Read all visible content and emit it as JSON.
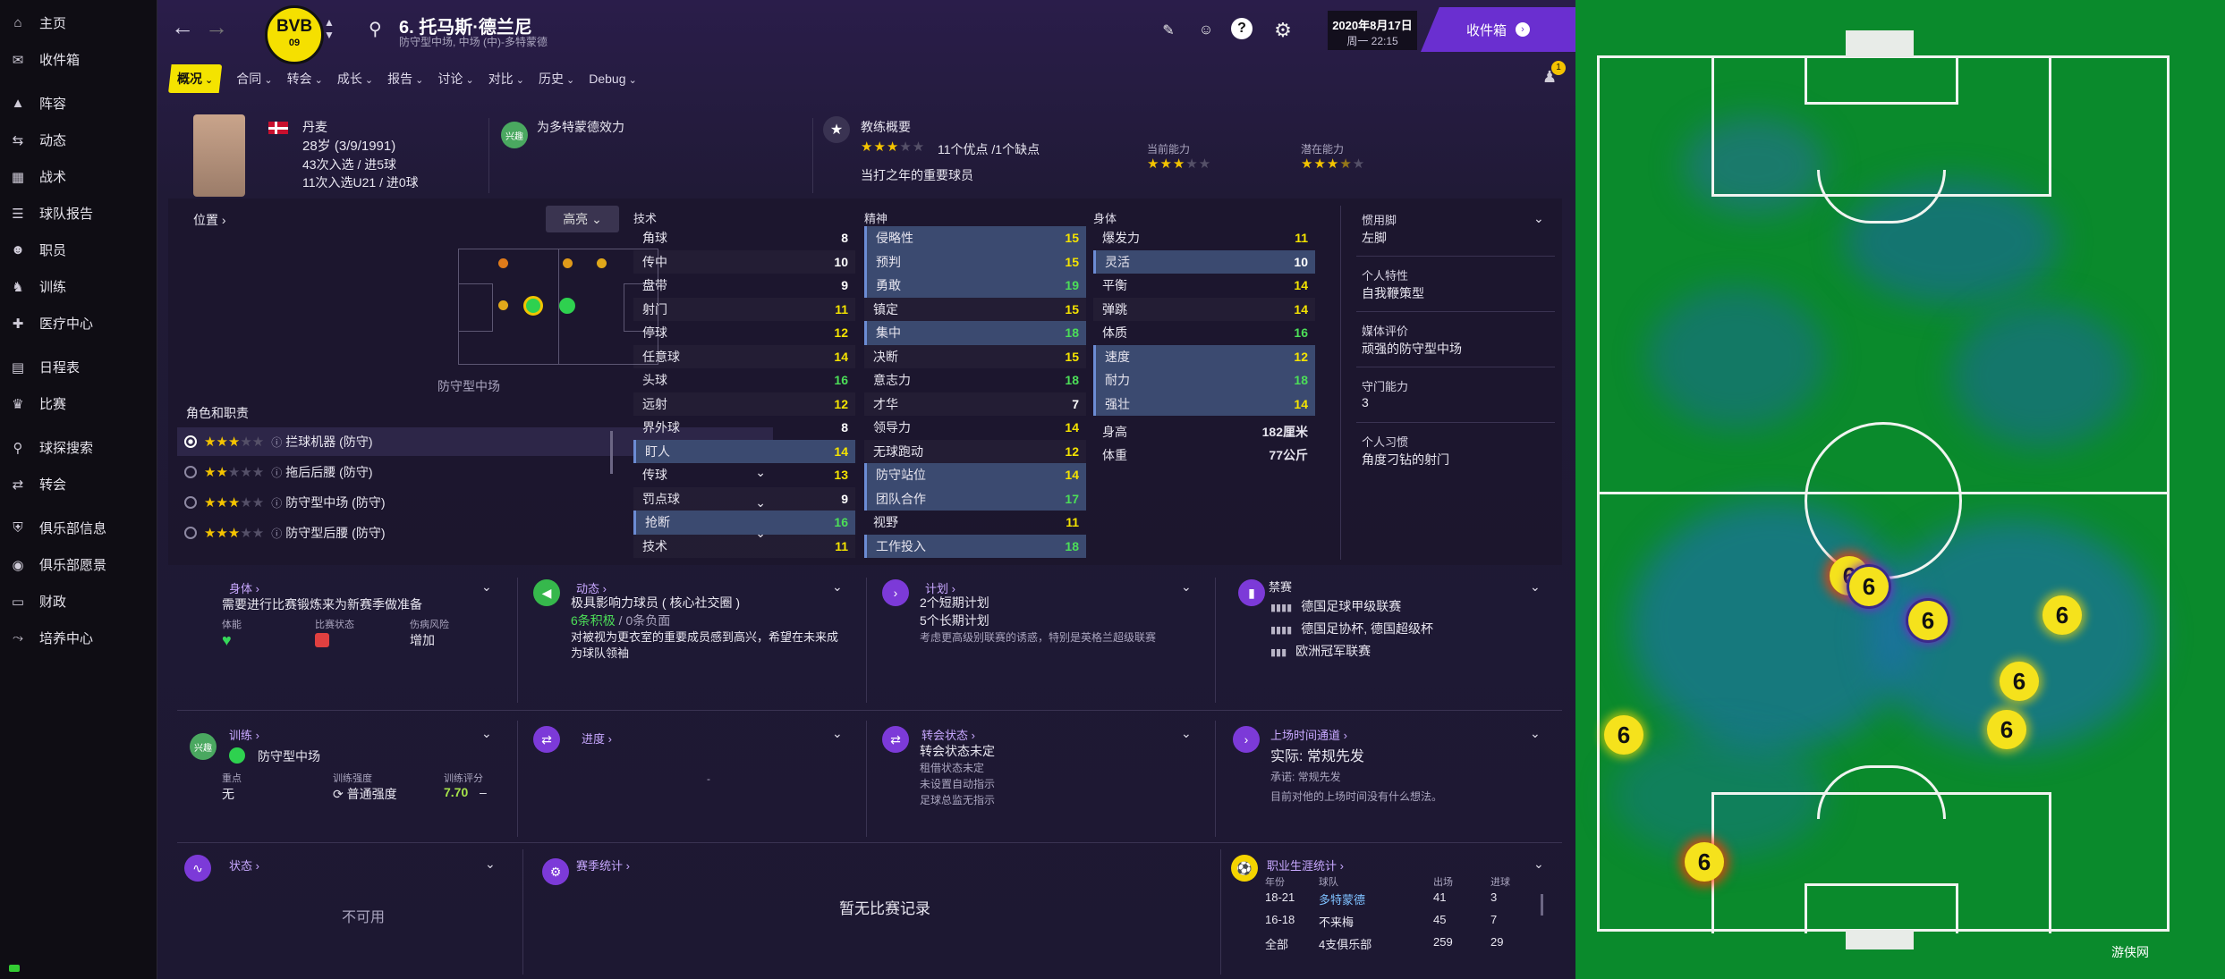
{
  "sidebar": {
    "items": [
      {
        "label": "主页",
        "icon": "home-icon"
      },
      {
        "label": "收件箱",
        "icon": "inbox-icon"
      },
      {
        "label": "阵容",
        "icon": "shirt-icon"
      },
      {
        "label": "动态",
        "icon": "dynamics-icon"
      },
      {
        "label": "战术",
        "icon": "tactics-icon"
      },
      {
        "label": "球队报告",
        "icon": "report-icon"
      },
      {
        "label": "职员",
        "icon": "staff-icon"
      },
      {
        "label": "训练",
        "icon": "training-icon"
      },
      {
        "label": "医疗中心",
        "icon": "medical-icon"
      },
      {
        "label": "日程表",
        "icon": "calendar-icon"
      },
      {
        "label": "比赛",
        "icon": "trophy-icon"
      },
      {
        "label": "球探搜索",
        "icon": "search-icon"
      },
      {
        "label": "转会",
        "icon": "transfer-icon"
      },
      {
        "label": "俱乐部信息",
        "icon": "shield-icon"
      },
      {
        "label": "俱乐部愿景",
        "icon": "vision-icon"
      },
      {
        "label": "财政",
        "icon": "finance-icon"
      },
      {
        "label": "培养中心",
        "icon": "development-icon"
      }
    ]
  },
  "header": {
    "crest_text": "BVB",
    "crest_year": "09",
    "player_name": "6. 托马斯·德兰尼",
    "player_sub": "防守型中场, 中场 (中)-多特蒙德",
    "date": "2020年8月17日",
    "time": "周一 22:15",
    "inbox_label": "收件箱",
    "notif_count": "1"
  },
  "tabs": [
    "概况",
    "合同",
    "转会",
    "成长",
    "报告",
    "讨论",
    "对比",
    "历史",
    "Debug"
  ],
  "profile": {
    "nation": "丹麦",
    "age_line": "28岁 (3/9/1991)",
    "caps_line": "43次入选 / 进5球",
    "u21_line": "11次入选U21 / 进0球",
    "club_badge": "兴趣",
    "club_line": "为多特蒙德效力",
    "coach_title": "教练概要",
    "coach_line": "11个优点 /1个缺点",
    "coach_desc": "当打之年的重要球员",
    "coach_stars": 3,
    "current_label": "当前能力",
    "current_stars": 3,
    "potential_label": "潜在能力",
    "potential_stars": 3.5
  },
  "position": {
    "title": "位置",
    "highlight_btn": "高亮",
    "pos_label": "防守型中场",
    "roles_title": "角色和职责",
    "roles": [
      {
        "name": "拦球机器 (防守)",
        "stars": 3
      },
      {
        "name": "拖后后腰 (防守)",
        "stars": 2
      },
      {
        "name": "防守型中场 (防守)",
        "stars": 3
      },
      {
        "name": "防守型后腰 (防守)",
        "stars": 3
      }
    ]
  },
  "attributes": {
    "tech_title": "技术",
    "mental_title": "精神",
    "phys_title": "身体",
    "technical": [
      {
        "n": "角球",
        "v": "8",
        "c": "w",
        "hl": false
      },
      {
        "n": "传中",
        "v": "10",
        "c": "w",
        "hl": false
      },
      {
        "n": "盘带",
        "v": "9",
        "c": "w",
        "hl": false
      },
      {
        "n": "射门",
        "v": "11",
        "c": "y",
        "hl": false
      },
      {
        "n": "停球",
        "v": "12",
        "c": "y",
        "hl": false
      },
      {
        "n": "任意球",
        "v": "14",
        "c": "y",
        "hl": false
      },
      {
        "n": "头球",
        "v": "16",
        "c": "g",
        "hl": false
      },
      {
        "n": "远射",
        "v": "12",
        "c": "y",
        "hl": false
      },
      {
        "n": "界外球",
        "v": "8",
        "c": "w",
        "hl": false
      },
      {
        "n": "盯人",
        "v": "14",
        "c": "y",
        "hl": true
      },
      {
        "n": "传球",
        "v": "13",
        "c": "y",
        "hl": false
      },
      {
        "n": "罚点球",
        "v": "9",
        "c": "w",
        "hl": false
      },
      {
        "n": "抢断",
        "v": "16",
        "c": "g",
        "hl": true
      },
      {
        "n": "技术",
        "v": "11",
        "c": "y",
        "hl": false
      }
    ],
    "mental": [
      {
        "n": "侵略性",
        "v": "15",
        "c": "y",
        "hl": true
      },
      {
        "n": "预判",
        "v": "15",
        "c": "y",
        "hl": true
      },
      {
        "n": "勇敢",
        "v": "19",
        "c": "g",
        "hl": true
      },
      {
        "n": "镇定",
        "v": "15",
        "c": "y",
        "hl": false
      },
      {
        "n": "集中",
        "v": "18",
        "c": "g",
        "hl": true
      },
      {
        "n": "决断",
        "v": "15",
        "c": "y",
        "hl": false
      },
      {
        "n": "意志力",
        "v": "18",
        "c": "g",
        "hl": false
      },
      {
        "n": "才华",
        "v": "7",
        "c": "w",
        "hl": false
      },
      {
        "n": "领导力",
        "v": "14",
        "c": "y",
        "hl": false
      },
      {
        "n": "无球跑动",
        "v": "12",
        "c": "y",
        "hl": false
      },
      {
        "n": "防守站位",
        "v": "14",
        "c": "y",
        "hl": true
      },
      {
        "n": "团队合作",
        "v": "17",
        "c": "g",
        "hl": true
      },
      {
        "n": "视野",
        "v": "11",
        "c": "y",
        "hl": false
      },
      {
        "n": "工作投入",
        "v": "18",
        "c": "g",
        "hl": true
      }
    ],
    "physical": [
      {
        "n": "爆发力",
        "v": "11",
        "c": "y",
        "hl": false
      },
      {
        "n": "灵活",
        "v": "10",
        "c": "w",
        "hl": true
      },
      {
        "n": "平衡",
        "v": "14",
        "c": "y",
        "hl": false
      },
      {
        "n": "弹跳",
        "v": "14",
        "c": "y",
        "hl": false
      },
      {
        "n": "体质",
        "v": "16",
        "c": "g",
        "hl": false
      },
      {
        "n": "速度",
        "v": "12",
        "c": "y",
        "hl": true
      },
      {
        "n": "耐力",
        "v": "18",
        "c": "g",
        "hl": true
      },
      {
        "n": "强壮",
        "v": "14",
        "c": "y",
        "hl": true
      }
    ],
    "height_label": "身高",
    "height_value": "182厘米",
    "weight_label": "体重",
    "weight_value": "77公斤"
  },
  "traits": [
    {
      "label": "惯用脚",
      "value": "左脚"
    },
    {
      "label": "个人特性",
      "value": "自我鞭策型"
    },
    {
      "label": "媒体评价",
      "value": "顽强的防守型中场"
    },
    {
      "label": "守门能力",
      "value": "3"
    },
    {
      "label": "个人习惯",
      "value": "角度刁钻的射门"
    }
  ],
  "cards": {
    "body": {
      "title": "身体",
      "desc": "需要进行比赛锻炼来为新赛季做准备",
      "l1": "体能",
      "l2": "比赛状态",
      "l3": "伤病风险",
      "v3": "增加"
    },
    "dyn": {
      "title": "动态",
      "line1": "极具影响力球员 ( 核心社交圈 )",
      "pos": "6条积极",
      "neg": " / 0条负面",
      "desc": "对被视为更衣室的重要成员感到高兴，希望在未来成为球队领袖"
    },
    "plan": {
      "title": "计划",
      "l1": "2个短期计划",
      "l2": "5个长期计划",
      "desc": "考虑更高级别联赛的诱惑，特别是英格兰超级联赛"
    },
    "ban": {
      "title": "禁赛",
      "items": [
        "德国足球甲级联赛",
        "德国足协杯, 德国超级杯",
        "欧洲冠军联赛"
      ]
    },
    "train": {
      "title": "训练",
      "badge": "兴趣",
      "role": "防守型中场",
      "focus_l": "重点",
      "focus_v": "无",
      "int_l": "训练强度",
      "int_v": "普通强度",
      "rating_l": "训练评分",
      "rating_v": "7.70"
    },
    "progress": {
      "title": "进度"
    },
    "transfer": {
      "title": "转会状态",
      "l1": "转会状态未定",
      "l2": "租借状态未定",
      "l3": "未设置自动指示",
      "l4": "足球总监无指示"
    },
    "playing": {
      "title": "上场时间通道",
      "l1": "实际: 常规先发",
      "l2": "承诺: 常规先发",
      "l3": "目前对他的上场时间没有什么想法。"
    },
    "form": {
      "title": "状态",
      "na": "不可用"
    },
    "season": {
      "title": "赛季统计",
      "none": "暂无比赛记录"
    },
    "career": {
      "title": "职业生涯统计",
      "h_year": "年份",
      "h_team": "球队",
      "h_apps": "出场",
      "h_goals": "进球",
      "rows": [
        {
          "y": "18-21",
          "t": "多特蒙德",
          "a": "41",
          "g": "3"
        },
        {
          "y": "16-18",
          "t": "不来梅",
          "a": "45",
          "g": "7"
        },
        {
          "y": "全部",
          "t": "4支俱乐部",
          "a": "259",
          "g": "29"
        }
      ]
    }
  },
  "heatmap_label": "6",
  "watermark": "游侠网"
}
